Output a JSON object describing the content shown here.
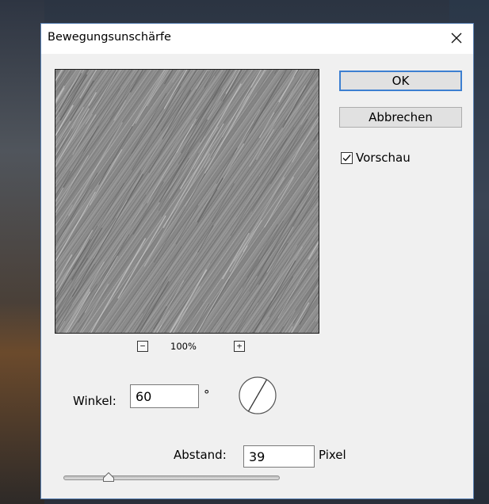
{
  "dialog": {
    "title": "Bewegungsunschärfe",
    "close_icon": "close-icon"
  },
  "preview": {
    "zoom_level": "100%",
    "zoom_out_icon": "minus-icon",
    "zoom_in_icon": "plus-icon",
    "zoom_out_glyph": "−",
    "zoom_in_glyph": "+"
  },
  "buttons": {
    "ok_label": "OK",
    "cancel_label": "Abbrechen"
  },
  "preview_checkbox": {
    "label": "Vorschau",
    "checked": true
  },
  "angle": {
    "label": "Winkel:",
    "value": "60",
    "unit": "°",
    "dial_icon": "angle-dial-icon"
  },
  "distance": {
    "label": "Abstand:",
    "value": "39",
    "unit": "Pixel",
    "slider_min": 1,
    "slider_max": 2000,
    "slider_value": 39
  },
  "colors": {
    "ok_border": "#3c7fd1",
    "dialog_bg": "#f0f0f0",
    "dialog_border": "#5a82b5"
  }
}
